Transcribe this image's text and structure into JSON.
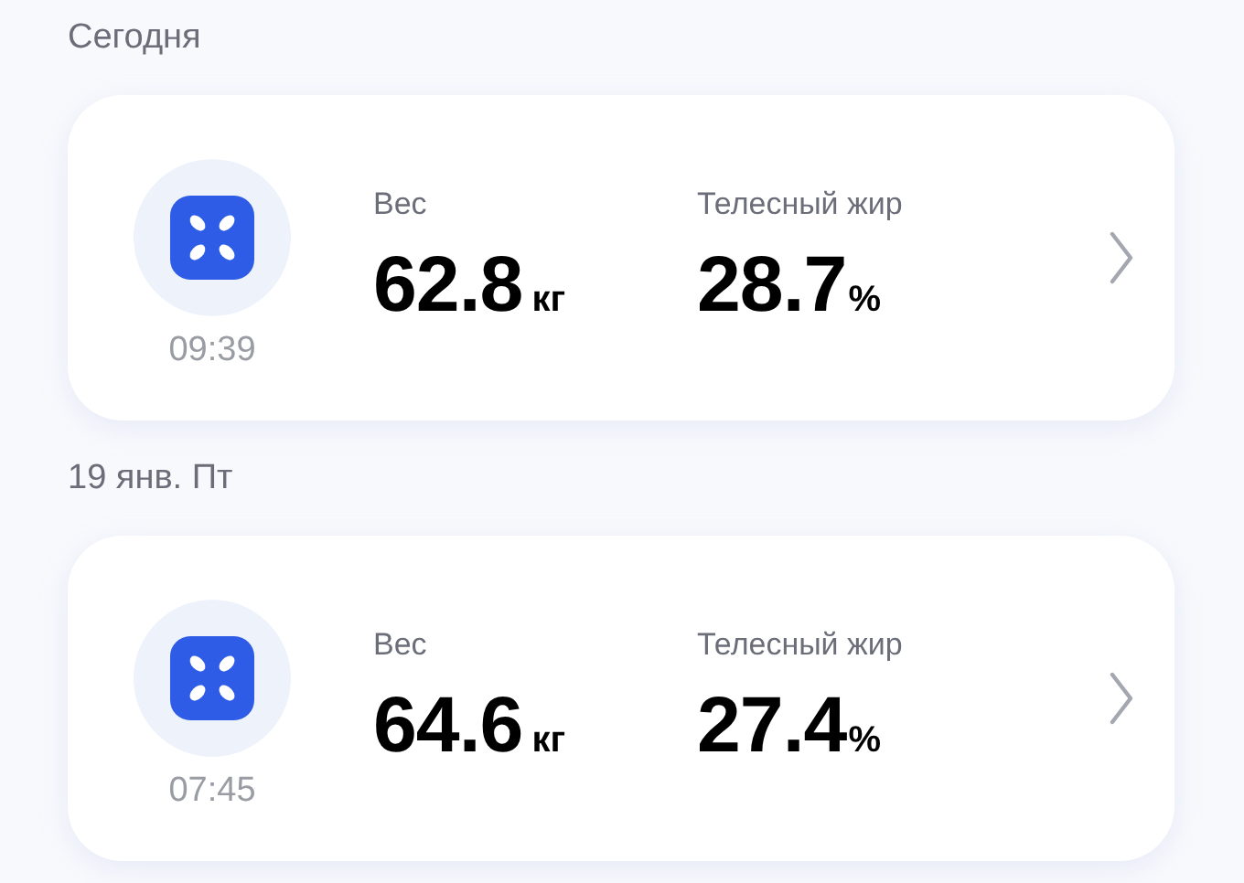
{
  "days": [
    {
      "heading": "Сегодня",
      "records": [
        {
          "time": "09:39",
          "metrics": [
            {
              "label": "Вес",
              "value": "62.8",
              "unit": "кг"
            },
            {
              "label": "Телесный жир",
              "value": "28.7",
              "unit": "%"
            }
          ]
        }
      ]
    },
    {
      "heading": "19 янв. Пт",
      "records": [
        {
          "time": "07:45",
          "metrics": [
            {
              "label": "Вес",
              "value": "64.6",
              "unit": "кг"
            },
            {
              "label": "Телесный жир",
              "value": "27.4",
              "unit": "%"
            }
          ]
        }
      ]
    }
  ]
}
